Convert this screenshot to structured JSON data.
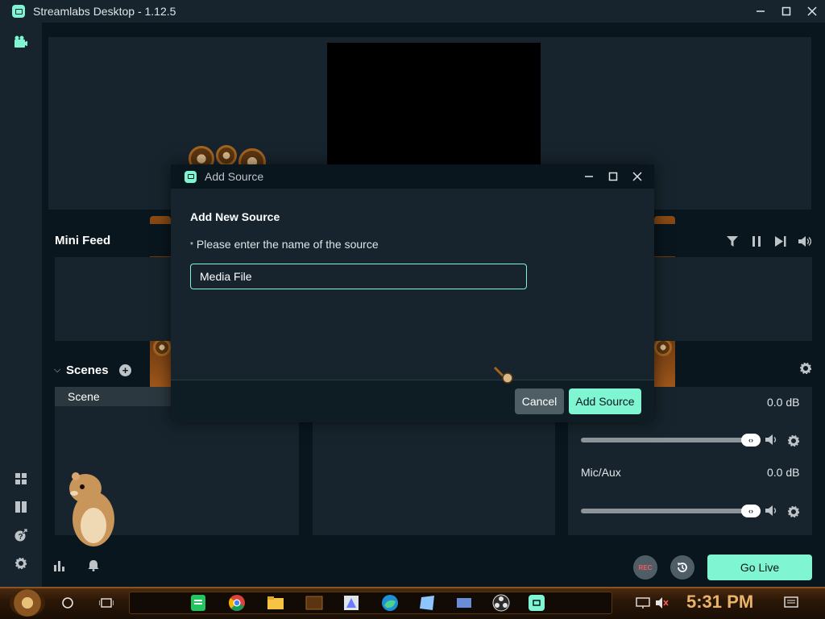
{
  "app": {
    "title": "Streamlabs Desktop - 1.12.5"
  },
  "window_controls": {
    "minimize": "—",
    "maximize": "☐",
    "close": "✕"
  },
  "mini_feed": {
    "title": "Mini Feed"
  },
  "scenes": {
    "title": "Scenes",
    "items": [
      {
        "label": "Scene"
      }
    ]
  },
  "mixer": {
    "channels": [
      {
        "name": "",
        "level": "0.0 dB"
      },
      {
        "name": "Mic/Aux",
        "level": "0.0 dB"
      }
    ]
  },
  "footer": {
    "rec_label": "REC",
    "go_live_label": "Go Live"
  },
  "modal": {
    "title": "Add Source",
    "heading": "Add New Source",
    "field_label": "Please enter the name of the source",
    "field_value": "Media File",
    "cancel_label": "Cancel",
    "submit_label": "Add Source"
  },
  "taskbar": {
    "clock": "5:31 PM"
  },
  "colors": {
    "accent": "#80f5d2",
    "panel": "#17242d",
    "background": "#09161d",
    "rec": "#f85961"
  }
}
